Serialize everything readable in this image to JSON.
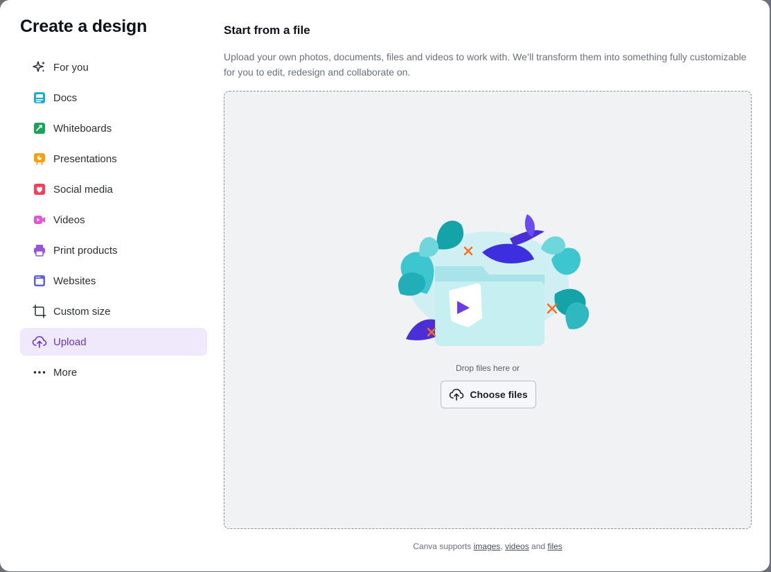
{
  "modal": {
    "title": "Create a design"
  },
  "sidebar": {
    "items": [
      {
        "label": "For you",
        "icon": "sparkle-icon",
        "color": "#2b2f33"
      },
      {
        "label": "Docs",
        "icon": "docs-icon",
        "color": "#13b1cc"
      },
      {
        "label": "Whiteboards",
        "icon": "whiteboard-icon",
        "color": "#1ba457"
      },
      {
        "label": "Presentations",
        "icon": "presentation-icon",
        "color": "#ff9d0a"
      },
      {
        "label": "Social media",
        "icon": "heart-icon",
        "color": "#ff3b58"
      },
      {
        "label": "Videos",
        "icon": "video-icon",
        "color": "#e452d8"
      },
      {
        "label": "Print products",
        "icon": "printer-icon",
        "color": "#9b51e0"
      },
      {
        "label": "Websites",
        "icon": "website-icon",
        "color": "#5a5ee8"
      },
      {
        "label": "Custom size",
        "icon": "custom-size-icon",
        "color": "#2b2f33"
      },
      {
        "label": "Upload",
        "icon": "upload-cloud-icon",
        "color": "#6833c8",
        "active": true
      },
      {
        "label": "More",
        "icon": "more-dots-icon",
        "color": "#2b2f33"
      }
    ]
  },
  "main": {
    "title": "Start from a file",
    "description": "Upload your own photos, documents, files and videos to work with. We’ll transform them into something fully customizable for you to edit, redesign and collaborate on.",
    "dropzone": {
      "drop_text": "Drop files here or",
      "button_label": "Choose files"
    },
    "footer": {
      "prefix": "Canva supports",
      "link_images": "images",
      "sep1": ",",
      "link_videos": "videos",
      "and": "and",
      "link_files": "files"
    }
  },
  "colors": {
    "accent": "#6833c8",
    "active_bg": "#f0e9fc",
    "dropzone_bg": "#f1f2f4"
  }
}
